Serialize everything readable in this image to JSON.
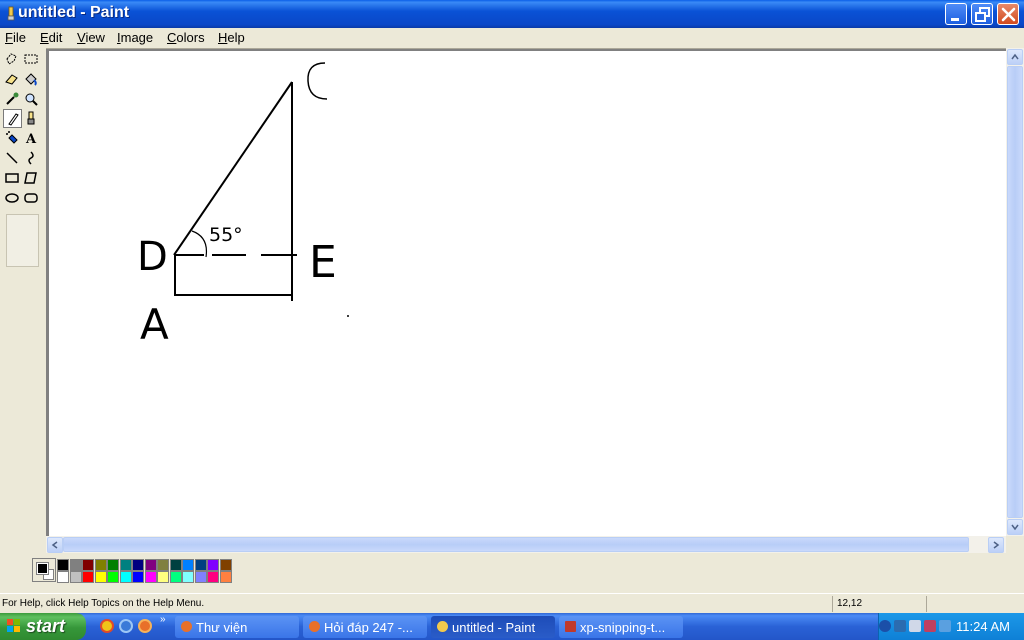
{
  "window": {
    "title": "untitled - Paint"
  },
  "menu": [
    "File",
    "Edit",
    "View",
    "Image",
    "Colors",
    "Help"
  ],
  "toolbox": {
    "tools": [
      "free-form-select-icon",
      "select-icon",
      "eraser-icon",
      "fill-with-color-icon",
      "pick-color-icon",
      "magnifier-icon",
      "pencil-icon",
      "brush-icon",
      "airbrush-icon",
      "text-icon",
      "line-icon",
      "curve-icon",
      "rectangle-icon",
      "polygon-icon",
      "ellipse-icon",
      "rounded-rectangle-icon"
    ],
    "active_tool": "pencil-icon",
    "text_tool_glyph": "A"
  },
  "canvas": {
    "labels": [
      {
        "id": "label-d",
        "text": "D"
      },
      {
        "id": "label-e",
        "text": "E"
      },
      {
        "id": "label-a",
        "text": "A"
      },
      {
        "id": "label-angle",
        "text": "55°"
      }
    ]
  },
  "palette": {
    "foreground": "#000000",
    "background": "#ffffff",
    "top_row": [
      "#000000",
      "#808080",
      "#800000",
      "#808000",
      "#008000",
      "#008080",
      "#000080",
      "#800080",
      "#808040",
      "#004040",
      "#0080ff",
      "#004080",
      "#8000ff",
      "#804000"
    ],
    "bottom_row": [
      "#ffffff",
      "#c0c0c0",
      "#ff0000",
      "#ffff00",
      "#00ff00",
      "#00ffff",
      "#0000ff",
      "#ff00ff",
      "#ffff80",
      "#00ff80",
      "#80ffff",
      "#8080ff",
      "#ff0080",
      "#ff8040"
    ]
  },
  "status": {
    "help_text": "For Help, click Help Topics on the Help Menu.",
    "coordinates": "12,12"
  },
  "taskbar": {
    "start_label": "start",
    "more_glyph": "»",
    "tasks": [
      {
        "label": "Thư viện",
        "icon_color": "#e8702a"
      },
      {
        "label": "Hỏi đáp 247 -...",
        "icon_color": "#e8702a"
      },
      {
        "label": "untitled - Paint",
        "icon_color": "#f2c94c"
      },
      {
        "label": "xp-snipping-t...",
        "icon_color": "#c0392b"
      }
    ],
    "clock": "11:24 AM"
  }
}
